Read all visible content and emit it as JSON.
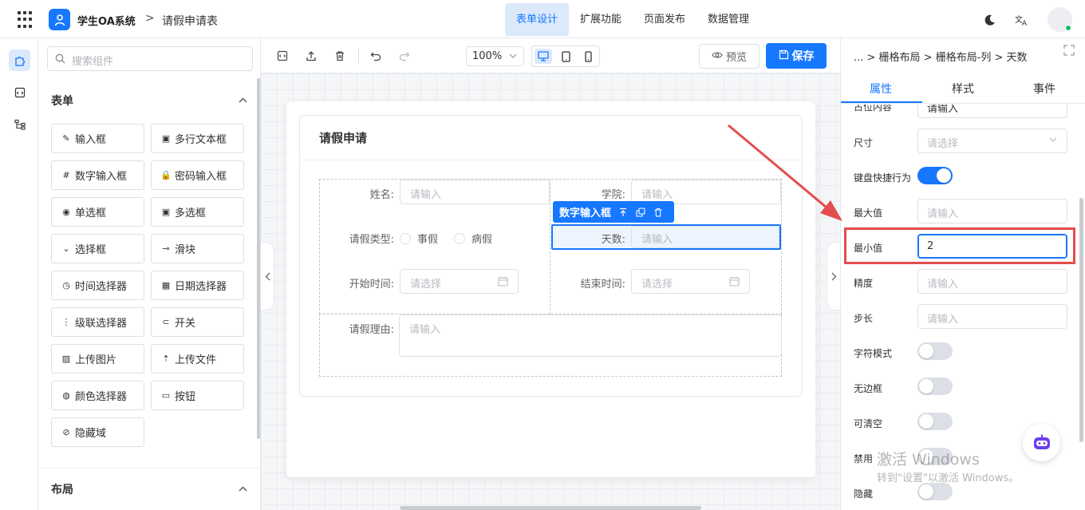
{
  "header": {
    "app_name": "学生OA系统",
    "separator": ">",
    "page_name": "请假申请表",
    "nav": [
      "表单设计",
      "扩展功能",
      "页面发布",
      "数据管理"
    ],
    "active_nav": "表单设计"
  },
  "components_panel": {
    "search_placeholder": "搜索组件",
    "form_group": {
      "title": "表单",
      "items": [
        {
          "label": "输入框",
          "icon": "pencil-icon"
        },
        {
          "label": "多行文本框",
          "icon": "textarea-icon"
        },
        {
          "label": "数字输入框",
          "icon": "number-icon"
        },
        {
          "label": "密码输入框",
          "icon": "lock-icon"
        },
        {
          "label": "单选框",
          "icon": "radio-icon"
        },
        {
          "label": "多选框",
          "icon": "checkbox-icon"
        },
        {
          "label": "选择框",
          "icon": "select-icon"
        },
        {
          "label": "滑块",
          "icon": "slider-icon"
        },
        {
          "label": "时间选择器",
          "icon": "clock-icon"
        },
        {
          "label": "日期选择器",
          "icon": "calendar-icon"
        },
        {
          "label": "级联选择器",
          "icon": "cascader-icon"
        },
        {
          "label": "开关",
          "icon": "switch-icon"
        },
        {
          "label": "上传图片",
          "icon": "image-icon"
        },
        {
          "label": "上传文件",
          "icon": "upload-icon"
        },
        {
          "label": "颜色选择器",
          "icon": "palette-icon"
        },
        {
          "label": "按钮",
          "icon": "button-icon"
        },
        {
          "label": "隐藏域",
          "icon": "eye-off-icon"
        }
      ]
    },
    "layout_group": {
      "title": "布局"
    }
  },
  "toolbar": {
    "zoom": "100%",
    "preview_label": "预览",
    "save_label": "保存"
  },
  "form": {
    "title": "请假申请",
    "fields": {
      "name_label": "姓名:",
      "college_label": "学院:",
      "leave_type_label": "请假类型:",
      "days_label": "天数:",
      "start_label": "开始时间:",
      "end_label": "结束时间:",
      "reason_label": "请假理由:"
    },
    "input_placeholder": "请输入",
    "select_placeholder": "请选择",
    "radio_options": [
      "事假",
      "病假"
    ],
    "selected_widget_label": "数字输入框"
  },
  "properties": {
    "breadcrumb": "... > 栅格布局 > 栅格布局-列 > 天数",
    "tabs": [
      "属性",
      "样式",
      "事件"
    ],
    "active_tab": "属性",
    "rows": {
      "placeholder_label": "占位内容",
      "placeholder_value": "请输入",
      "size_label": "尺寸",
      "size_placeholder": "请选择",
      "keyboard_label": "键盘快捷行为",
      "keyboard_on": true,
      "max_label": "最大值",
      "max_placeholder": "请输入",
      "min_label": "最小值",
      "min_value": "2",
      "precision_label": "精度",
      "precision_placeholder": "请输入",
      "step_label": "步长",
      "step_placeholder": "请输入",
      "string_mode_label": "字符模式",
      "borderless_label": "无边框",
      "clearable_label": "可清空",
      "disabled_label": "禁用",
      "hidden_label": "隐藏"
    }
  },
  "watermark": {
    "line1": "激活 Windows",
    "line2": "转到\"设置\"以激活 Windows。"
  },
  "colors": {
    "primary": "#1677ff",
    "annotation": "#e34d4d"
  }
}
